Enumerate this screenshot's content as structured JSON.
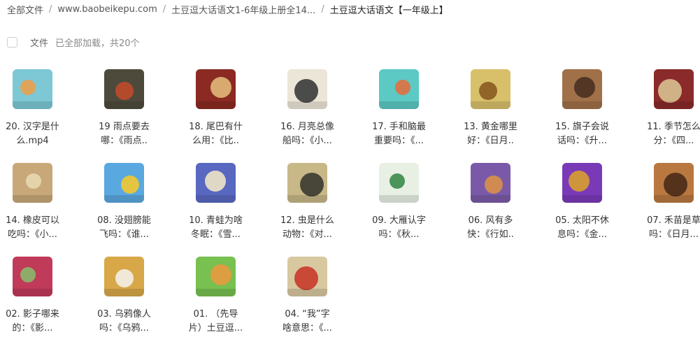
{
  "breadcrumb": [
    "全部文件",
    "www.baobeikepu.com",
    "土豆逗大话语文1-6年级上册全14...",
    "土豆逗大话语文【一年级上】"
  ],
  "toolbar": {
    "column_label": "文件",
    "status": "已全部加载，共20个"
  },
  "files": [
    {
      "name": "20. 汉字是什\n么.mp4",
      "icon": "cartoon-kids-thumbnail",
      "bg": "#7ec8d6",
      "fg": "#e8a04c"
    },
    {
      "name": "19 雨点要去\n哪：《雨点..",
      "icon": "ant-thumbnail",
      "bg": "#4d4a3c",
      "fg": "#c04a2a"
    },
    {
      "name": "18. 尾巴有什\n么用：《比..",
      "icon": "animal-thumbnail",
      "bg": "#8a2a22",
      "fg": "#e0b878"
    },
    {
      "name": "16. 月亮总像\n船吗：《小...",
      "icon": "character-chart-thumbnail",
      "bg": "#ece6d8",
      "fg": "#3a3a3a"
    },
    {
      "name": "17. 手和脑最\n重要吗：《...",
      "icon": "cartoon-boy-thumbnail",
      "bg": "#5cc9c4",
      "fg": "#e07040"
    },
    {
      "name": "13. 黄金哪里\n好：《日月..",
      "icon": "golden-mask-thumbnail",
      "bg": "#d8c06a",
      "fg": "#8a5a20"
    },
    {
      "name": "15. 旗子会说\n话吗：《升...",
      "icon": "scene-thumbnail",
      "bg": "#a07048",
      "fg": "#4a3020"
    },
    {
      "name": "11. 季节怎么\n分：《四...",
      "icon": "stage-thumbnail",
      "bg": "#8a2a2a",
      "fg": "#d8c090"
    },
    {
      "name": "14. 橡皮可以\n吃吗：《小...",
      "icon": "eraser-thumbnail",
      "bg": "#c8a878",
      "fg": "#e8d8b0"
    },
    {
      "name": "08. 没翅膀能\n飞吗：《谁...",
      "icon": "sun-thumbnail",
      "bg": "#5aa8e0",
      "fg": "#f2c830"
    },
    {
      "name": "10. 青蛙为啥\n冬眠：《雪...",
      "icon": "pattern-thumbnail",
      "bg": "#5868c0",
      "fg": "#f0e4c8"
    },
    {
      "name": "12. 虫是什么\n动物：《对...",
      "icon": "bronze-vessel-thumbnail",
      "bg": "#c8b888",
      "fg": "#3a3a30"
    },
    {
      "name": "09. 大雁认字\n吗：《秋...",
      "icon": "birds-thumbnail",
      "bg": "#e8f0e4",
      "fg": "#3a8a4a"
    },
    {
      "name": "06. 风有多\n快：《行如..",
      "icon": "purple-scene-thumbnail",
      "bg": "#7a5aa8",
      "fg": "#d89048"
    },
    {
      "name": "05. 太阳不休\n息吗：《金...",
      "icon": "figure-thumbnail",
      "bg": "#7a3ab8",
      "fg": "#d8a030"
    },
    {
      "name": "07. 禾苗是草\n吗：《日月...",
      "icon": "person-thumbnail",
      "bg": "#b87840",
      "fg": "#4a2a18"
    },
    {
      "name": "02. 影子哪来\n的：《影...",
      "icon": "photo-collage-thumbnail",
      "bg": "#c03a5a",
      "fg": "#8ab86a"
    },
    {
      "name": "03. 乌鸦像人\n吗：《乌鸦...",
      "icon": "white-horse-thumbnail",
      "bg": "#d8a848",
      "fg": "#f4f0e8"
    },
    {
      "name": "01. （先导\n片）土豆逗...",
      "icon": "book-thumbnail",
      "bg": "#78c050",
      "fg": "#e89a40"
    },
    {
      "name": "04. “我”字\n啥意思：《...",
      "icon": "character-wo-thumbnail",
      "bg": "#d8c8a0",
      "fg": "#c83a2a"
    }
  ]
}
